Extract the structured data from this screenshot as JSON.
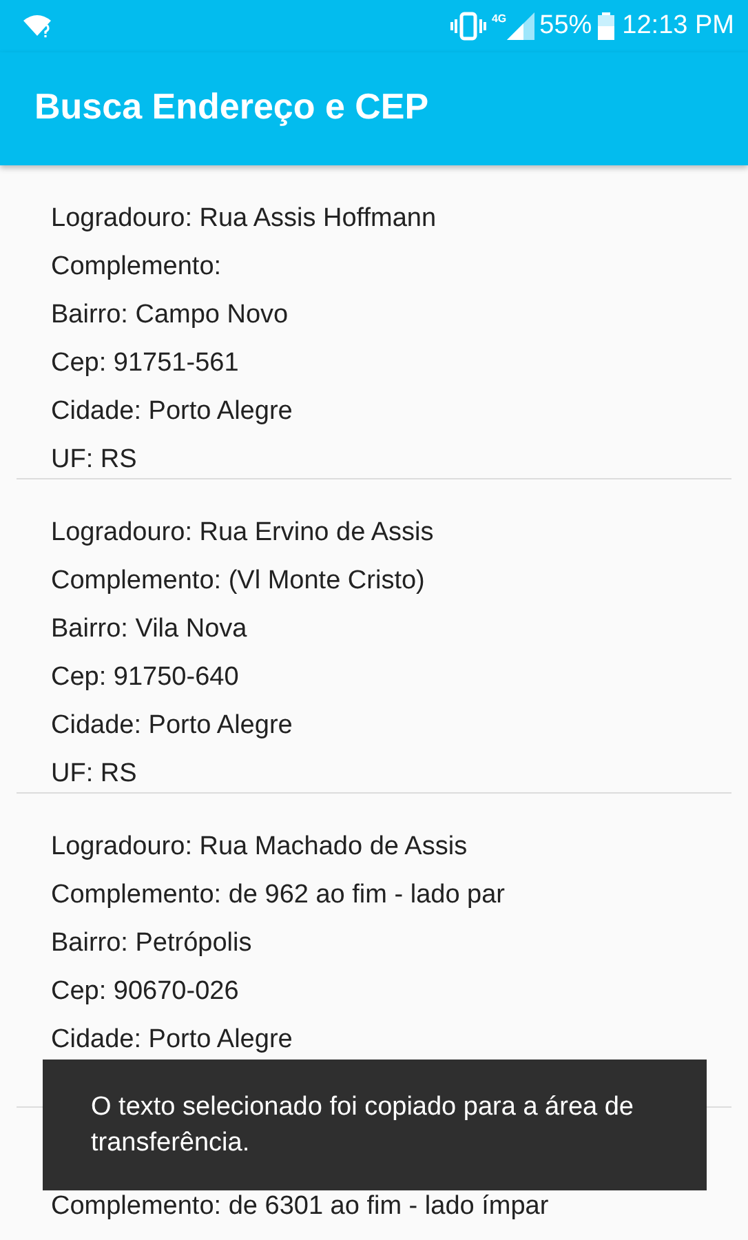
{
  "status_bar": {
    "battery": "55%",
    "time": "12:13 PM",
    "network": "4G"
  },
  "app_bar": {
    "title": "Busca Endereço e CEP"
  },
  "results": [
    {
      "lines": [
        "Logradouro: Rua Assis Hoffmann",
        "Complemento:",
        "Bairro: Campo Novo",
        "Cep: 91751-561",
        "Cidade: Porto Alegre",
        "UF: RS"
      ]
    },
    {
      "lines": [
        "Logradouro: Rua Ervino de Assis",
        "Complemento: (Vl Monte Cristo)",
        "Bairro: Vila Nova",
        "Cep: 91750-640",
        "Cidade: Porto Alegre",
        "UF: RS"
      ]
    },
    {
      "lines": [
        "Logradouro: Rua Machado de Assis",
        "Complemento: de 962 ao fim - lado par",
        "Bairro: Petrópolis",
        "Cep: 90670-026",
        "Cidade: Porto Alegre"
      ]
    },
    {
      "lines": [
        "Complemento: de 6301 ao fim - lado ímpar"
      ]
    }
  ],
  "toast": {
    "message": "O texto selecionado foi copiado para a área de transferência."
  }
}
